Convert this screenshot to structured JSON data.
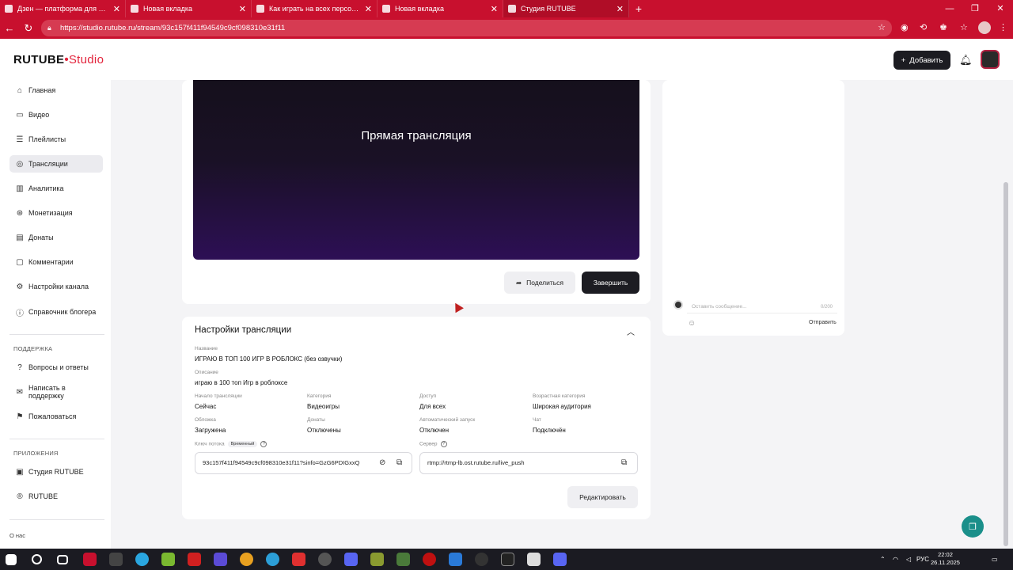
{
  "browser": {
    "tabs": [
      {
        "label": "Дзен — платформа для просмо"
      },
      {
        "label": "Новая вкладка"
      },
      {
        "label": "Как играть на всех персонажах"
      },
      {
        "label": "Новая вкладка"
      },
      {
        "label": "Студия RUTUBE"
      }
    ],
    "url": "https://studio.rutube.ru/stream/93c157f411f94549c9cf098310e31f11"
  },
  "header": {
    "logo_main": "RUTUBE",
    "logo_studio": "Studio",
    "add_label": "Добавить"
  },
  "sidebar": {
    "items": [
      {
        "label": "Главная"
      },
      {
        "label": "Видео"
      },
      {
        "label": "Плейлисты"
      },
      {
        "label": "Трансляции"
      },
      {
        "label": "Аналитика"
      },
      {
        "label": "Монетизация"
      },
      {
        "label": "Донаты"
      },
      {
        "label": "Комментарии"
      },
      {
        "label": "Настройки канала"
      },
      {
        "label": "Справочник блогера"
      }
    ],
    "support_head": "ПОДДЕРЖКА",
    "support_items": [
      {
        "label": "Вопросы и ответы"
      },
      {
        "label": "Написать в поддержку"
      },
      {
        "label": "Пожаловаться"
      }
    ],
    "apps_head": "ПРИЛОЖЕНИЯ",
    "apps_items": [
      {
        "label": "Студия RUTUBE"
      },
      {
        "label": "RUTUBE"
      }
    ],
    "footer_about": "О нас"
  },
  "player": {
    "title": "Прямая трансляция",
    "share_label": "Поделиться",
    "finish_label": "Завершить"
  },
  "settings": {
    "title": "Настройки трансляции",
    "name_label": "Название",
    "name_value": "ИГРАЮ В ТОП 100 ИГР В РОБЛОКС (без озвучки)",
    "desc_label": "Описание",
    "desc_value": "играю в 100 топ Игр в роблоксе",
    "start_label": "Начало трансляции",
    "start_value": "Сейчас",
    "category_label": "Категория",
    "category_value": "Видеоигры",
    "access_label": "Доступ",
    "access_value": "Для всех",
    "age_label": "Возрастная категория",
    "age_value": "Широкая аудитория",
    "cover_label": "Обложка",
    "cover_value": "Загружена",
    "donates_label": "Донаты",
    "donates_value": "Отключены",
    "autostart_label": "Автоматический запуск",
    "autostart_value": "Отключен",
    "chat_label": "Чат",
    "chat_value": "Подключён",
    "key_label": "Ключ потока",
    "key_badge": "Временный",
    "key_value": "93c157f411f94549c9cf098310e31f11?sinfo=GzG6PDIGxxQ",
    "server_label": "Сервер",
    "server_value": "rtmp://rtmp-lb.ost.rutube.ru/live_push",
    "edit_label": "Редактировать"
  },
  "chat": {
    "placeholder": "Оставить сообщение...",
    "counter": "0/200",
    "send_label": "Отправить"
  },
  "taskbar": {
    "lang": "РУС",
    "time": "22:02",
    "date": "26.11.2025"
  },
  "colors": {
    "browser_red": "#c8102e",
    "brand_red": "#e3243c",
    "dark_button": "#1c1c22",
    "helper_teal": "#1a8f8a"
  }
}
